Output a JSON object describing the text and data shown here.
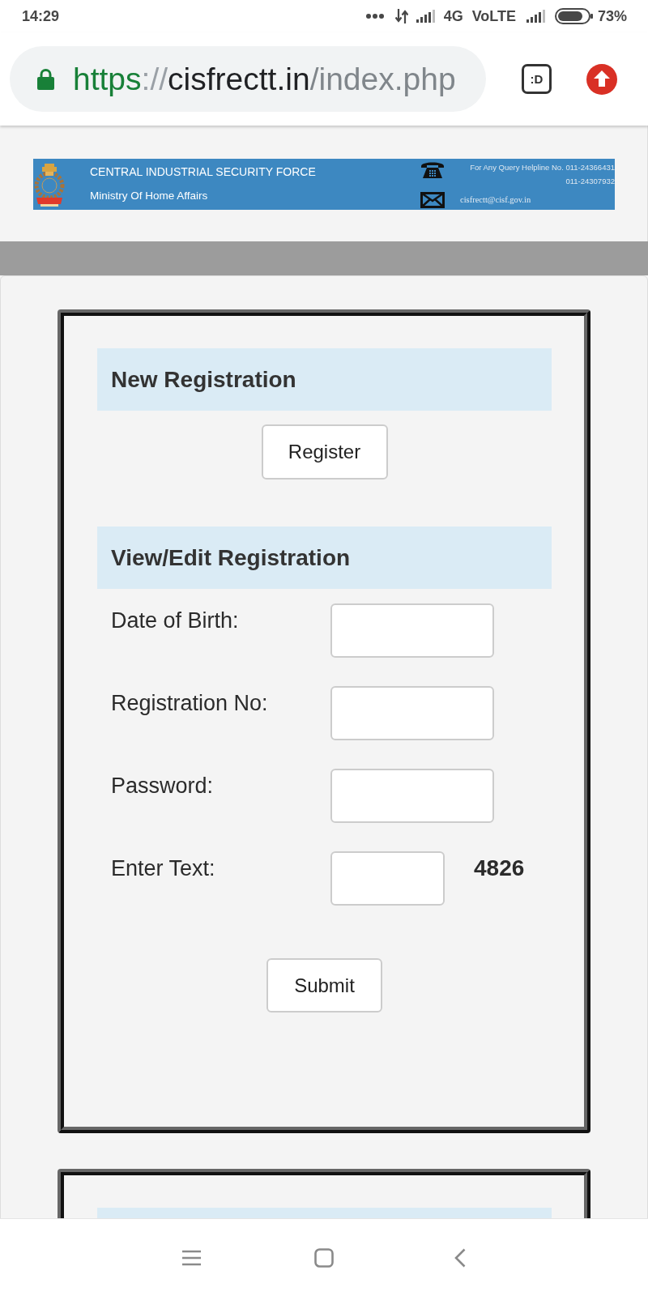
{
  "status_bar": {
    "time": "14:29",
    "network": "4G",
    "volte": "VoLTE",
    "battery": "73%"
  },
  "browser": {
    "url": {
      "scheme": "https",
      "separator": "://",
      "host": "cisfrectt.in",
      "path": "/index.php"
    },
    "extension_badge": ":D"
  },
  "banner": {
    "title": "CENTRAL INDUSTRIAL SECURITY FORCE",
    "subtitle": "Ministry Of Home Affairs",
    "helpline": "For Any Query Helpline No. 011-24366431",
    "helpline_2": "011-24307932",
    "email": "cisfrectt@cisf.gov.in"
  },
  "new_registration": {
    "heading": "New Registration",
    "button": "Register"
  },
  "view_edit": {
    "heading": "View/Edit Registration",
    "fields": [
      {
        "kind": "input",
        "label": "Date of Birth:"
      },
      {
        "kind": "input",
        "label": "Registration No:"
      },
      {
        "kind": "input",
        "label": "Password:"
      },
      {
        "kind": "captcha",
        "label": "Enter Text:",
        "code": "4826"
      }
    ],
    "button": "Submit"
  }
}
